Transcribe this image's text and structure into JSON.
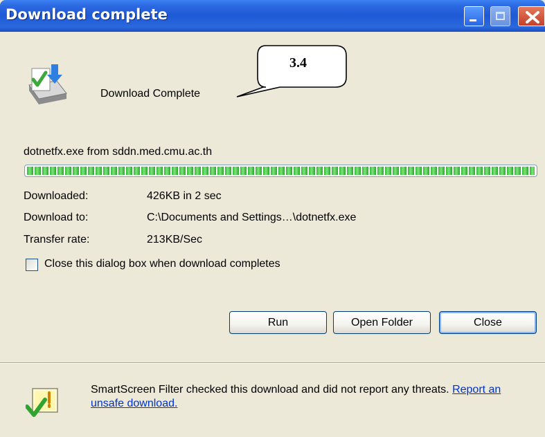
{
  "window": {
    "title": "Download complete",
    "minimize_label": "minimize",
    "maximize_label": "maximize",
    "close_label": "close"
  },
  "header": {
    "status": "Download Complete",
    "icon": "download-complete-icon"
  },
  "callout": {
    "text": "3.4"
  },
  "file": {
    "source": "dotnetfx.exe from sddn.med.cmu.ac.th",
    "progress_fraction": 1.0
  },
  "details": [
    {
      "label": "Downloaded:",
      "value": "426KB in 2 sec"
    },
    {
      "label": "Download to:",
      "value": "C:\\Documents and Settings…\\dotnetfx.exe"
    },
    {
      "label": "Transfer rate:",
      "value": "213KB/Sec"
    }
  ],
  "options": {
    "close_on_complete_label": "Close this dialog box when download completes",
    "close_on_complete_checked": false
  },
  "buttons": {
    "run": "Run",
    "open_folder": "Open Folder",
    "close": "Close"
  },
  "smartscreen": {
    "icon": "smartscreen-shield-icon",
    "message": "SmartScreen Filter checked this download and did not report any threats.",
    "link": "Report an unsafe download."
  },
  "colors": {
    "title_bar": "#2a67e0",
    "window_bg": "#ece9d8",
    "progress_green": "#33b833",
    "link": "#0033cc"
  }
}
